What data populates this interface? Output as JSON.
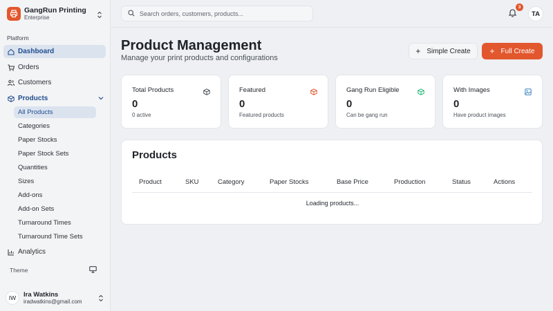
{
  "brand": {
    "name": "GangRun Printing",
    "subtitle": "Enterprise",
    "accent": "#e2572d"
  },
  "sidebar": {
    "section_label": "Platform",
    "items": [
      {
        "label": "Dashboard",
        "icon": "home-icon",
        "active": true
      },
      {
        "label": "Orders",
        "icon": "cart-icon"
      },
      {
        "label": "Customers",
        "icon": "users-icon"
      },
      {
        "label": "Products",
        "icon": "package-icon",
        "expanded": true
      },
      {
        "label": "Analytics",
        "icon": "chart-icon"
      }
    ],
    "product_subitems": [
      "All Products",
      "Categories",
      "Paper Stocks",
      "Paper Stock Sets",
      "Quantities",
      "Sizes",
      "Add-ons",
      "Add-on Sets",
      "Turnaround Times",
      "Turnaround Time Sets"
    ],
    "theme_label": "Theme"
  },
  "user": {
    "initials": "IW",
    "name": "Ira Watkins",
    "email": "iradwatkins@gmail.com"
  },
  "topbar": {
    "search_placeholder": "Search orders, customers, products...",
    "notification_count": "3",
    "avatar_initials": "TA"
  },
  "header": {
    "title": "Product Management",
    "subtitle": "Manage your print products and configurations",
    "simple_create": "Simple Create",
    "full_create": "Full Create"
  },
  "stats": [
    {
      "title": "Total Products",
      "value": "0",
      "desc": "0 active",
      "icon": "box-icon",
      "color": "#4b5057"
    },
    {
      "title": "Featured",
      "value": "0",
      "desc": "Featured products",
      "icon": "box-icon",
      "color": "#e2572d"
    },
    {
      "title": "Gang Run Eligible",
      "value": "0",
      "desc": "Can be gang run",
      "icon": "box-icon",
      "color": "#22b573"
    },
    {
      "title": "With Images",
      "value": "0",
      "desc": "Have product images",
      "icon": "image-icon",
      "color": "#3b82c4"
    }
  ],
  "products_table": {
    "title": "Products",
    "columns": [
      "Product",
      "SKU",
      "Category",
      "Paper Stocks",
      "Base Price",
      "Production",
      "Status",
      "Actions"
    ],
    "loading_text": "Loading products..."
  }
}
